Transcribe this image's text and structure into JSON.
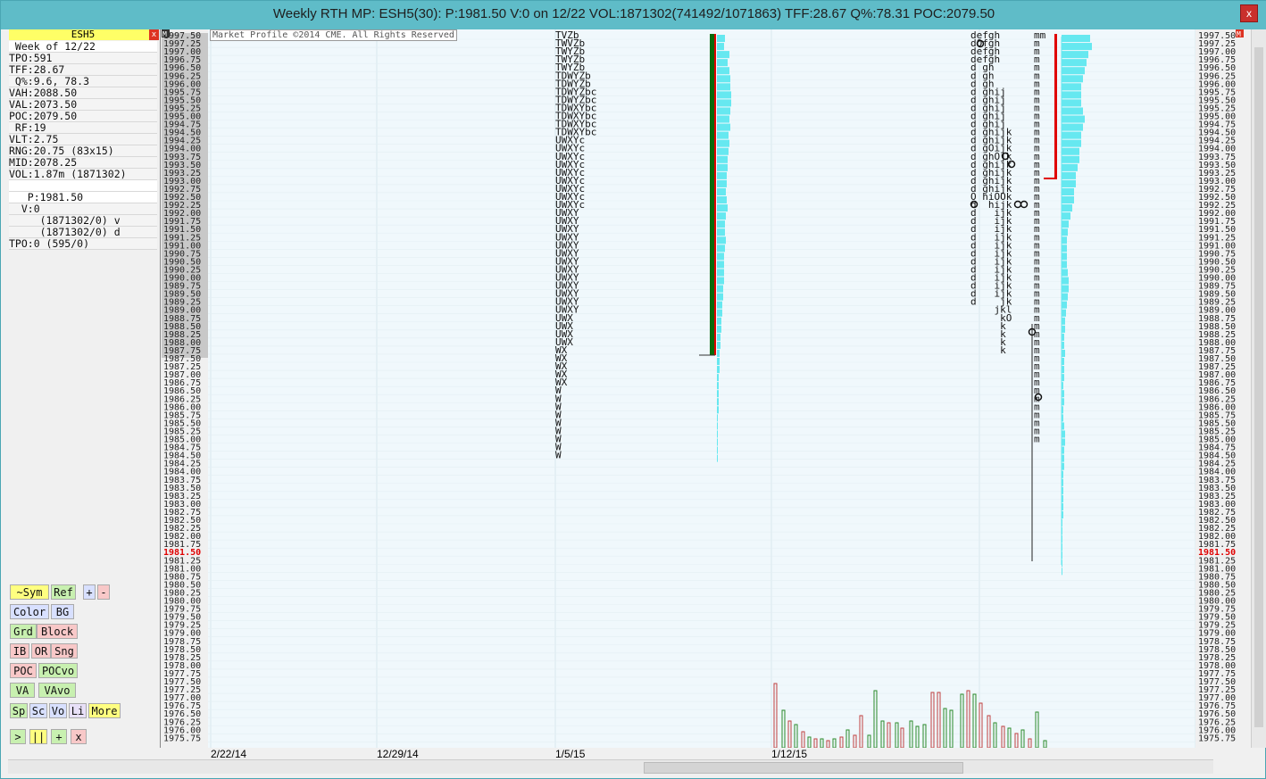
{
  "window": {
    "title": "Weekly RTH MP: ESH5(30): P:1981.50 V:0 on 12/22 VOL:1871302(741492/1071863) TFF:28.67 Q%:78.31 POC:2079.50",
    "close_label": "x"
  },
  "info_panel": {
    "symbol": "ESH5",
    "close_label": "x",
    "rows": [
      " Week of 12/22",
      "TPO:591",
      "TFF:28.67",
      " Q%:9.6, 78.3",
      "VAH:2088.50",
      "VAL:2073.50",
      "POC:2079.50",
      " RF:19",
      "VLT:2.75",
      "RNG:20.75 (83x15)",
      "MID:2078.25",
      "VOL:1.87m (1871302)",
      "",
      "   P:1981.50",
      "  V:0",
      "     (1871302/0) v",
      "     (1871302/0) d",
      "TPO:0 (595/0)"
    ]
  },
  "buttons": {
    "row1": [
      "~Sym",
      "Ref",
      "+",
      "-"
    ],
    "row2": [
      "Color",
      "BG"
    ],
    "row3": [
      "Grd",
      "Block"
    ],
    "row4": [
      "IB",
      "OR",
      "Sng"
    ],
    "row5": [
      "POC",
      "POCvo"
    ],
    "row6": [
      "VA",
      "VAvo"
    ],
    "row7": [
      "Sp",
      "Sc",
      "Vo",
      "Li",
      "More"
    ],
    "row8": [
      ">",
      "||",
      "+",
      "x"
    ]
  },
  "chart": {
    "copyright": "Market Profile ©2014 CME. All Rights Reserved",
    "left_corner_label": "M",
    "right_corner_label": "M",
    "price_axis": {
      "top": 1997.5,
      "bottom": 1975.75,
      "step": 0.25,
      "current_price": "1981.50"
    },
    "date_labels": [
      "2/22/14",
      "12/29/14",
      "1/5/15",
      "1/12/15"
    ],
    "colors": {
      "current_price": "#e00000",
      "volume_profile": "#66e8f0",
      "poc_line_red": "#e00000",
      "poc_line_green": "#0a6a0a",
      "vol_up": "#2a8a2a",
      "vol_down": "#c04040"
    }
  },
  "chart_data": {
    "type": "table",
    "profile_1_letters": [
      "TVZb",
      "TWVZb",
      "TWYZb",
      "TWYZb",
      "TWYZb",
      "TDWYZb",
      "TDWYZb",
      "TDWYZbc",
      "TDWYZbc",
      "TDWXYbc",
      "TDWXYbc",
      "TDWXYbc",
      "TDWXYbc",
      "UWXYc",
      "UWXYc",
      "UWXYc",
      "UWXYc",
      "UWXYc",
      "UWXYc",
      "UWXYc",
      "UWXYc",
      "UWXYc",
      "UWXY",
      "UWXY",
      "UWXY",
      "UWXY",
      "UWXY",
      "UWXY",
      "UWXY",
      "UWXY",
      "UWXY",
      "UWXY",
      "UWXY",
      "UWXY",
      "UWXY",
      "UWX",
      "UWX",
      "UWX",
      "UWX",
      "WX",
      "WX",
      "WX",
      "WX",
      "WX",
      "W",
      "W",
      "W",
      "W",
      "W",
      "W",
      "W",
      "W",
      "W"
    ],
    "profile_2_letters": [
      "defgh",
      "dOfgh",
      "defgh",
      "defgh",
      "d gh",
      "d gh",
      "d gh",
      "d ghij",
      "d ghij",
      "d ghij",
      "d ghij",
      "d ghij",
      "d ghijk",
      "d ghijk",
      "d gOijk",
      "d ghOjk",
      "d ghijk",
      "d ghijk",
      "d ghijk",
      "d ghijk",
      "O hiOOk",
      "d  hijk",
      "d   ijk",
      "d   ijk",
      "d   ijk",
      "d   ijk",
      "d   ijk",
      "d   ijk",
      "d   ijk",
      "d   ijk",
      "d   ijk",
      "d   ijk",
      "d   ijk",
      "d    jk",
      "    jkl",
      "     kO",
      "     k",
      "     k",
      "     k",
      "     k"
    ]
  }
}
